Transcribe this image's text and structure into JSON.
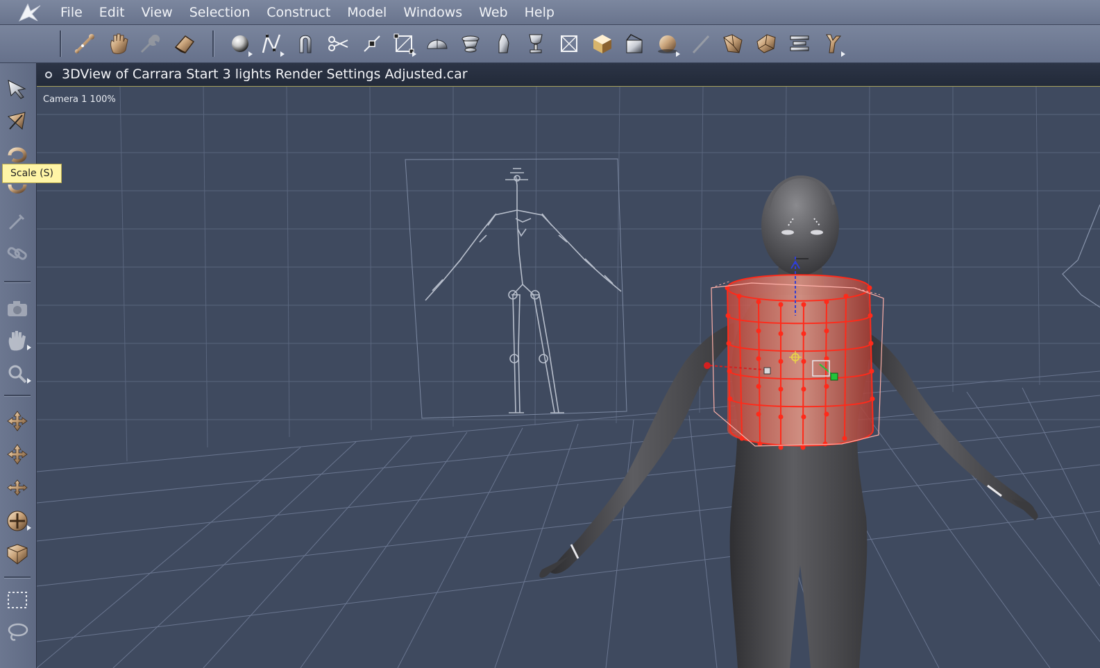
{
  "menubar": {
    "logo_icon": "carrara-logo-icon",
    "items": [
      "File",
      "Edit",
      "View",
      "Selection",
      "Construct",
      "Model",
      "Windows",
      "Web",
      "Help"
    ]
  },
  "toolbar": {
    "tools": [
      {
        "name": "bones-tool-icon"
      },
      {
        "name": "hand-grab-icon"
      },
      {
        "name": "wrench-tool-icon"
      },
      {
        "name": "eraser-tool-icon"
      },
      {
        "name": "sphere-primitive-icon"
      },
      {
        "name": "spline-tool-icon"
      },
      {
        "name": "magnet-icon"
      },
      {
        "name": "scissors-icon"
      },
      {
        "name": "point-tool-icon"
      },
      {
        "name": "bounding-box-icon"
      },
      {
        "name": "half-dome-icon"
      },
      {
        "name": "lathe-icon"
      },
      {
        "name": "glove-icon"
      },
      {
        "name": "trophy-icon"
      },
      {
        "name": "plane-icon"
      },
      {
        "name": "cube-icon"
      },
      {
        "name": "box-open-icon"
      },
      {
        "name": "sphere-lit-icon"
      },
      {
        "name": "wand-icon"
      },
      {
        "name": "shape-morph-icon"
      },
      {
        "name": "shape-twist-icon"
      },
      {
        "name": "align-icon"
      },
      {
        "name": "figure-icon"
      }
    ]
  },
  "left_tools": [
    {
      "name": "arrow-select-icon"
    },
    {
      "name": "direct-select-icon"
    },
    {
      "name": "rotate-icon"
    },
    {
      "name": "scale-icon"
    },
    {
      "name": "eyedropper-icon"
    },
    {
      "name": "chain-link-icon"
    },
    {
      "name": "camera-icon"
    },
    {
      "name": "pan-hand-icon"
    },
    {
      "name": "zoom-magnifier-icon"
    },
    {
      "name": "move-xy-icon"
    },
    {
      "name": "move-xz-icon"
    },
    {
      "name": "move-yz-icon"
    },
    {
      "name": "move-all-icon"
    },
    {
      "name": "view-cube-icon"
    },
    {
      "name": "marquee-select-icon"
    },
    {
      "name": "lasso-select-icon"
    }
  ],
  "tooltip": {
    "text": "Scale (S)"
  },
  "viewport": {
    "title": "3DView of Carrara Start 3 lights Render Settings Adjusted.car",
    "camera_label": "Camera 1 100%"
  },
  "colors": {
    "menubar_bg": "#6f7a93",
    "viewport_bg": "#3f4a5f",
    "grid_line": "#64718a",
    "selection_red": "#ff2a1a",
    "figure_gray": "#4d4d50",
    "tooltip_bg": "#fff5a6"
  }
}
